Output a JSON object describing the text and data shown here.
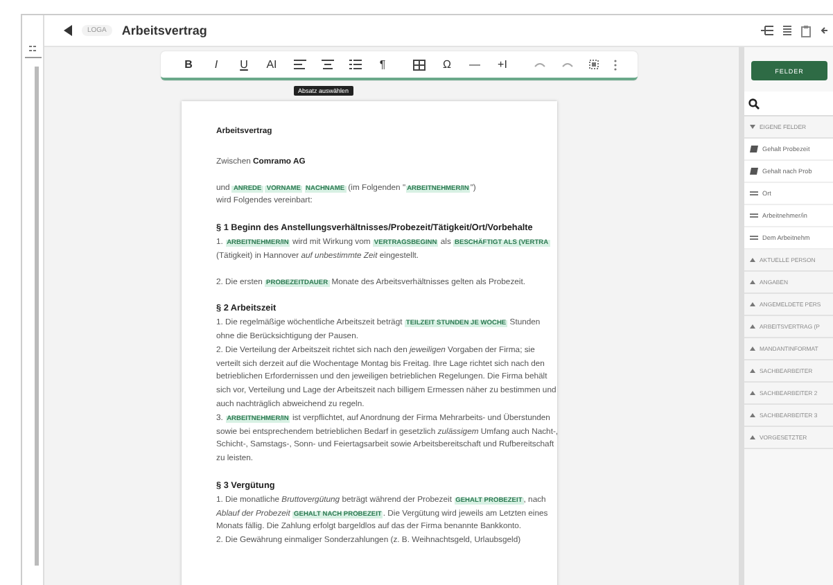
{
  "header": {
    "badge": "LOGA",
    "title": "Arbeitsvertrag"
  },
  "toolbar": [
    {
      "kind": "glyph",
      "label": "B"
    },
    {
      "kind": "glyph",
      "label": "I"
    },
    {
      "kind": "glyph",
      "label": "U"
    },
    {
      "kind": "glyph",
      "label": "AI"
    },
    {
      "kind": "align-left"
    },
    {
      "kind": "align-center"
    },
    {
      "kind": "list"
    },
    {
      "kind": "glyph",
      "label": "¶"
    },
    {
      "kind": "table"
    },
    {
      "kind": "glyph",
      "label": "Ω"
    },
    {
      "kind": "glyph",
      "label": "—"
    },
    {
      "kind": "glyph",
      "label": "+I"
    },
    {
      "kind": "undo"
    },
    {
      "kind": "redo"
    },
    {
      "kind": "select"
    },
    {
      "kind": "more"
    }
  ],
  "tooltip": "Absatz auswählen",
  "document": [
    {
      "kind": "title",
      "segments": [
        {
          "kind": "text",
          "text": "Arbeitsvertrag"
        }
      ]
    },
    {
      "kind": "para",
      "segments": [
        {
          "kind": "text",
          "text": "Zwischen "
        },
        {
          "kind": "bold",
          "text": "Comramo AG"
        }
      ]
    },
    {
      "kind": "para",
      "segments": [
        {
          "kind": "text",
          "text": "und "
        },
        {
          "kind": "field",
          "text": "ANREDE"
        },
        {
          "kind": "field",
          "text": "VORNAME"
        },
        {
          "kind": "field",
          "text": "NACHNAME"
        },
        {
          "kind": "text",
          "text": " (im Folgenden \""
        },
        {
          "kind": "field",
          "text": "ARBEITNEHMER/IN"
        },
        {
          "kind": "text",
          "text": "\")"
        },
        {
          "kind": "break"
        },
        {
          "kind": "text",
          "text": "wird Folgendes vereinbart:"
        }
      ]
    },
    {
      "kind": "heading",
      "segments": [
        {
          "kind": "text",
          "text": "§ 1 Beginn des Anstellungsverhältnisses/Probezeit/Tätigkeit/Ort/Vorbehalte"
        },
        {
          "kind": "break"
        },
        {
          "kind": "text",
          "text": "1. "
        },
        {
          "kind": "field",
          "text": "ARBEITNEHMER/IN"
        },
        {
          "kind": "text",
          "text": " wird mit Wirkung vom "
        },
        {
          "kind": "field",
          "text": "VERTRAGSBEGINN"
        },
        {
          "kind": "text",
          "text": " als "
        },
        {
          "kind": "field",
          "text": "BESCHÄFTIGT ALS (VERTRA"
        },
        {
          "kind": "text",
          "text": " (Tätigkeit) in Hannover "
        },
        {
          "kind": "italic",
          "text": "auf unbestimmte Zeit"
        },
        {
          "kind": "text",
          "text": " eingestellt."
        }
      ]
    },
    {
      "kind": "para",
      "segments": [
        {
          "kind": "text",
          "text": "2. Die ersten "
        },
        {
          "kind": "field",
          "text": "PROBEZEITDAUER"
        },
        {
          "kind": "text",
          "text": " Monate des Arbeitsverhältnisses gelten als Probezeit."
        }
      ]
    },
    {
      "kind": "heading",
      "segments": [
        {
          "kind": "text",
          "text": "§ 2 Arbeitszeit"
        },
        {
          "kind": "break"
        },
        {
          "kind": "text",
          "text": "1. Die regelmäßige wöchentliche Arbeitszeit beträgt "
        },
        {
          "kind": "field",
          "text": "TEILZEIT STUNDEN JE WOCHE"
        },
        {
          "kind": "text",
          "text": " Stunden ohne die Berücksichtigung der Pausen."
        },
        {
          "kind": "break"
        },
        {
          "kind": "text",
          "text": "2. Die Verteilung der Arbeitszeit richtet sich nach den "
        },
        {
          "kind": "italic",
          "text": "jeweiligen"
        },
        {
          "kind": "text",
          "text": " Vorgaben der Firma; sie verteilt sich derzeit auf die Wochentage Montag bis Freitag. Ihre Lage richtet sich nach den betrieblichen Erfordernissen und den jeweiligen betrieblichen Regelungen. Die Firma behält sich vor, Verteilung und Lage der Arbeitszeit nach billigem Ermessen näher zu bestimmen und auch nachträglich abweichend zu regeln."
        },
        {
          "kind": "break"
        },
        {
          "kind": "text",
          "text": "3. "
        },
        {
          "kind": "field",
          "text": "ARBEITNEHMER/IN"
        },
        {
          "kind": "text",
          "text": " ist verpflichtet, auf Anordnung der Firma Mehrarbeits- und Überstunden sowie bei entsprechendem betrieblichen Bedarf in gesetzlich "
        },
        {
          "kind": "italic",
          "text": "zulässigem"
        },
        {
          "kind": "text",
          "text": " Umfang auch Nacht-, Schicht-, Samstags-, Sonn- und Feiertagsarbeit sowie Arbeitsbereitschaft und Rufbereitschaft zu leisten."
        }
      ]
    },
    {
      "kind": "heading",
      "segments": [
        {
          "kind": "text",
          "text": "§ 3 Vergütung"
        },
        {
          "kind": "break"
        },
        {
          "kind": "text",
          "text": "1. Die monatliche "
        },
        {
          "kind": "italic",
          "text": "Bruttovergütung"
        },
        {
          "kind": "text",
          "text": " beträgt während der Probezeit "
        },
        {
          "kind": "field",
          "text": "GEHALT PROBEZEIT"
        },
        {
          "kind": "text",
          "text": ", nach "
        },
        {
          "kind": "italic",
          "text": "Ablauf der Probezeit"
        },
        {
          "kind": "field",
          "text": "GEHALT NACH PROBEZEIT"
        },
        {
          "kind": "text",
          "text": ". Die Vergütung wird jeweils am Letzten eines Monats fällig. Die Zahlung erfolgt bargeldlos auf das der Firma benannte Bankkonto."
        },
        {
          "kind": "break"
        },
        {
          "kind": "text",
          "text": "2. Die Gewährung einmaliger Sonderzahlungen (z. B. Weihnachtsgeld, Urlaubsgeld)"
        }
      ]
    }
  ],
  "panel": {
    "button": "FELDER",
    "sections": [
      {
        "label": "EIGENE FELDER",
        "expanded": true,
        "items": [
          {
            "kind": "formula",
            "label": "Gehalt Probezeit"
          },
          {
            "kind": "formula",
            "label": "Gehalt nach Prob"
          },
          {
            "kind": "text",
            "label": "Ort"
          },
          {
            "kind": "text",
            "label": "Arbeitnehmer/in"
          },
          {
            "kind": "text",
            "label": "Dem Arbeitnehm"
          }
        ]
      },
      {
        "label": "AKTUELLE PERSON",
        "expanded": false
      },
      {
        "label": "ANGABEN",
        "expanded": false
      },
      {
        "label": "ANGEMELDETE PERS",
        "expanded": false
      },
      {
        "label": "ARBEITSVERTRAG (P",
        "expanded": false
      },
      {
        "label": "MANDANTINFORMAT",
        "expanded": false
      },
      {
        "label": "SACHBEARBEITER",
        "expanded": false
      },
      {
        "label": "SACHBEARBEITER 2",
        "expanded": false
      },
      {
        "label": "SACHBEARBEITER 3",
        "expanded": false
      },
      {
        "label": "VORGESETZTER",
        "expanded": false
      }
    ]
  }
}
